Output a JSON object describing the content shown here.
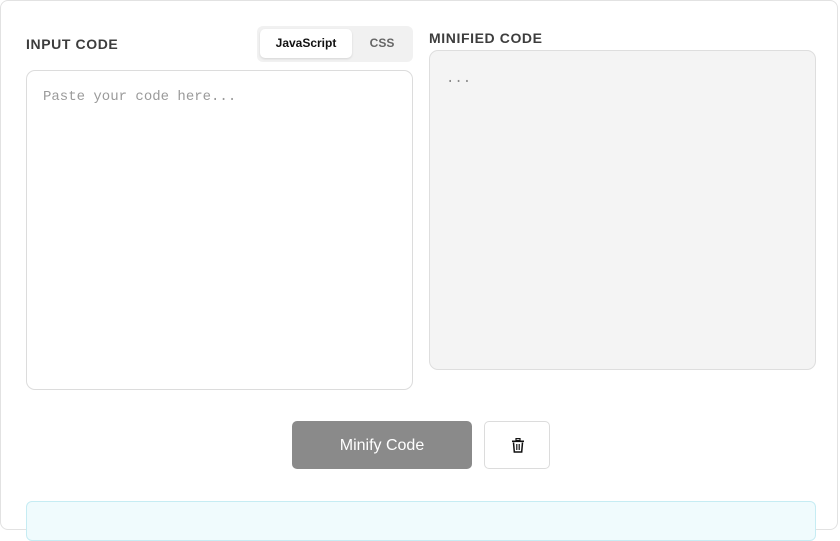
{
  "input_panel": {
    "label": "INPUT CODE",
    "placeholder": "Paste your code here...",
    "value": ""
  },
  "language_toggle": {
    "options": [
      "JavaScript",
      "CSS"
    ],
    "selected": "JavaScript"
  },
  "output_panel": {
    "label": "MINIFIED CODE",
    "value": "..."
  },
  "actions": {
    "minify_label": "Minify Code",
    "clear_icon": "trash-icon"
  },
  "colors": {
    "minify_button": "#8a8a8a",
    "output_background": "#f4f4f4",
    "info_background": "#f0fbfd"
  }
}
